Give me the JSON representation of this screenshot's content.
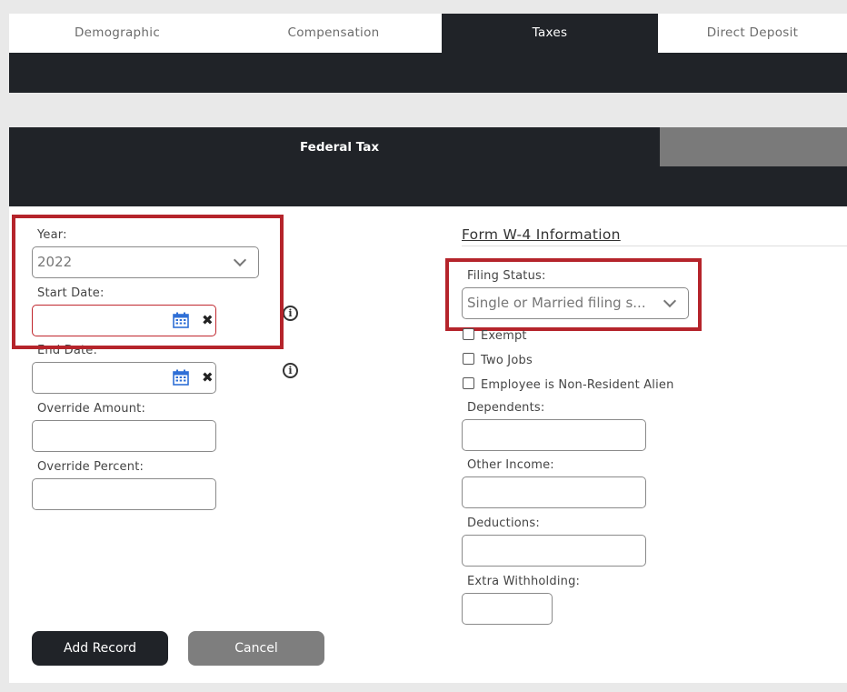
{
  "tabs": [
    {
      "label": "Demographic"
    },
    {
      "label": "Compensation"
    },
    {
      "label": "Taxes"
    },
    {
      "label": "Direct Deposit"
    }
  ],
  "active_tab": "Taxes",
  "section": {
    "title": "Federal Tax"
  },
  "left_form": {
    "year_label": "Year:",
    "year_value": "2022",
    "start_date_label": "Start Date:",
    "start_date_value": "",
    "end_date_label": "End Date:",
    "end_date_value": "",
    "override_amount_label": "Override Amount:",
    "override_amount_value": "",
    "override_percent_label": "Override Percent:",
    "override_percent_value": ""
  },
  "w4": {
    "title": "Form W-4 Information",
    "filing_status_label": "Filing Status:",
    "filing_status_value": "Single or Married filing s...",
    "exempt_label": "Exempt",
    "two_jobs_label": "Two Jobs",
    "nonresident_label": "Employee is Non-Resident Alien",
    "dependents_label": "Dependents:",
    "other_income_label": "Other Income:",
    "deductions_label": "Deductions:",
    "extra_withholding_label": "Extra Withholding:"
  },
  "buttons": {
    "add_record": "Add Record",
    "cancel": "Cancel"
  },
  "colors": {
    "dark": "#202328",
    "highlight": "#b5242b",
    "error": "#c0262d",
    "calendar_blue": "#2f6fd6"
  }
}
